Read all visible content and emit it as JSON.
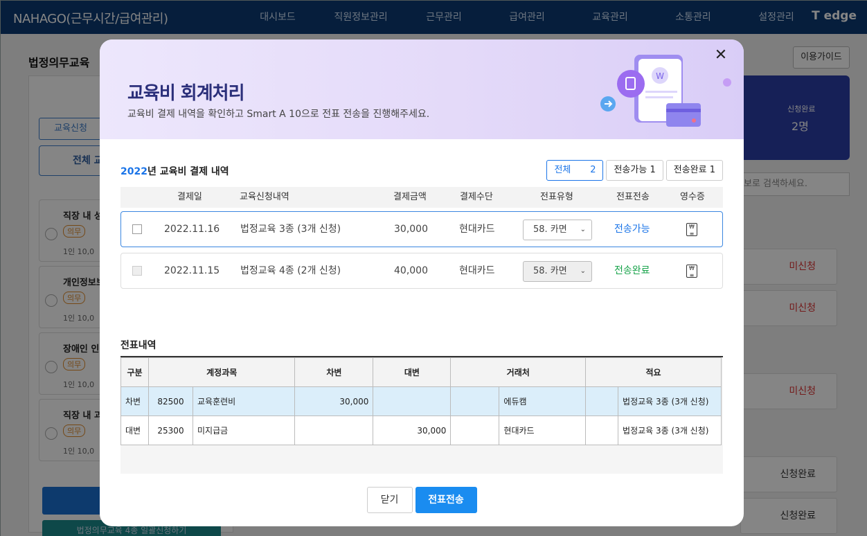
{
  "app": {
    "brand": "NAHAGO(근무시간/급여관리)",
    "menu": [
      "대시보드",
      "직원정보관리",
      "근무관리",
      "급여관리",
      "교육관리",
      "소통관리",
      "설정관리"
    ],
    "logo": "edge"
  },
  "page": {
    "title": "법정의무교육",
    "guide": "이용가이드",
    "tab_apply": "교육신청",
    "all_button": "전체 교",
    "left_cards": [
      {
        "title": "직장 내 성",
        "badge": "의무",
        "desc": "1인 10,0"
      },
      {
        "title": "개인정보보",
        "badge": "의무",
        "desc": "1인 10,0"
      },
      {
        "title": "장애인 인식",
        "badge": "의무",
        "desc": "1인 10,0"
      },
      {
        "title": "직장 내 괴",
        "badge": "의무",
        "desc": "1인 10,0"
      }
    ],
    "bulk_apply": "법정의무교육 4종 일괄신청하기",
    "summary_label": "신청완료",
    "summary_value": "2명",
    "search_placeholder": "보로 검색하세요.",
    "right_statuses": [
      "미신청",
      "미신청",
      "미신청",
      "신청완료",
      "신청완료"
    ]
  },
  "modal": {
    "title": "교육비 회계처리",
    "subtitle": "교육비 결제 내역을 확인하고 Smart A 10으로 전표 전송을 진행해주세요.",
    "section_year": "2022",
    "section_title": "년 교육비 결제 내역",
    "filters": [
      {
        "label": "전체",
        "count": "2"
      },
      {
        "label": "전송가능",
        "count": "1"
      },
      {
        "label": "전송완료",
        "count": "1"
      }
    ],
    "columns": [
      "결제일",
      "교육신청내역",
      "결제금액",
      "결제수단",
      "전표유형",
      "전표전송",
      "영수증"
    ],
    "payments": [
      {
        "date": "2022.11.16",
        "desc": "법정교육 3종 (3개 신청)",
        "amount": "30,000",
        "method": "현대카드",
        "type": "58. 카면",
        "status": "전송가능",
        "status_color": "#1a74e8"
      },
      {
        "date": "2022.11.15",
        "desc": "법정교육 4종 (2개 신청)",
        "amount": "40,000",
        "method": "현대카드",
        "type": "58. 카면",
        "status": "전송완료",
        "status_color": "#17a34a"
      }
    ],
    "journal_title": "전표내역",
    "journal_columns": [
      "구분",
      "계정과목",
      "차변",
      "대변",
      "거래처",
      "적요"
    ],
    "journal_rows": [
      {
        "kind": "차변",
        "code": "82500",
        "account": "교육훈련비",
        "debit": "30,000",
        "credit": "",
        "partner": "에듀캠",
        "memo": "법정교육 3종 (3개 신청)"
      },
      {
        "kind": "대변",
        "code": "25300",
        "account": "미지급금",
        "debit": "",
        "credit": "30,000",
        "partner": "현대카드",
        "memo": "법정교육 3종 (3개 신청)"
      }
    ],
    "close_button": "닫기",
    "send_button": "전표전송"
  }
}
